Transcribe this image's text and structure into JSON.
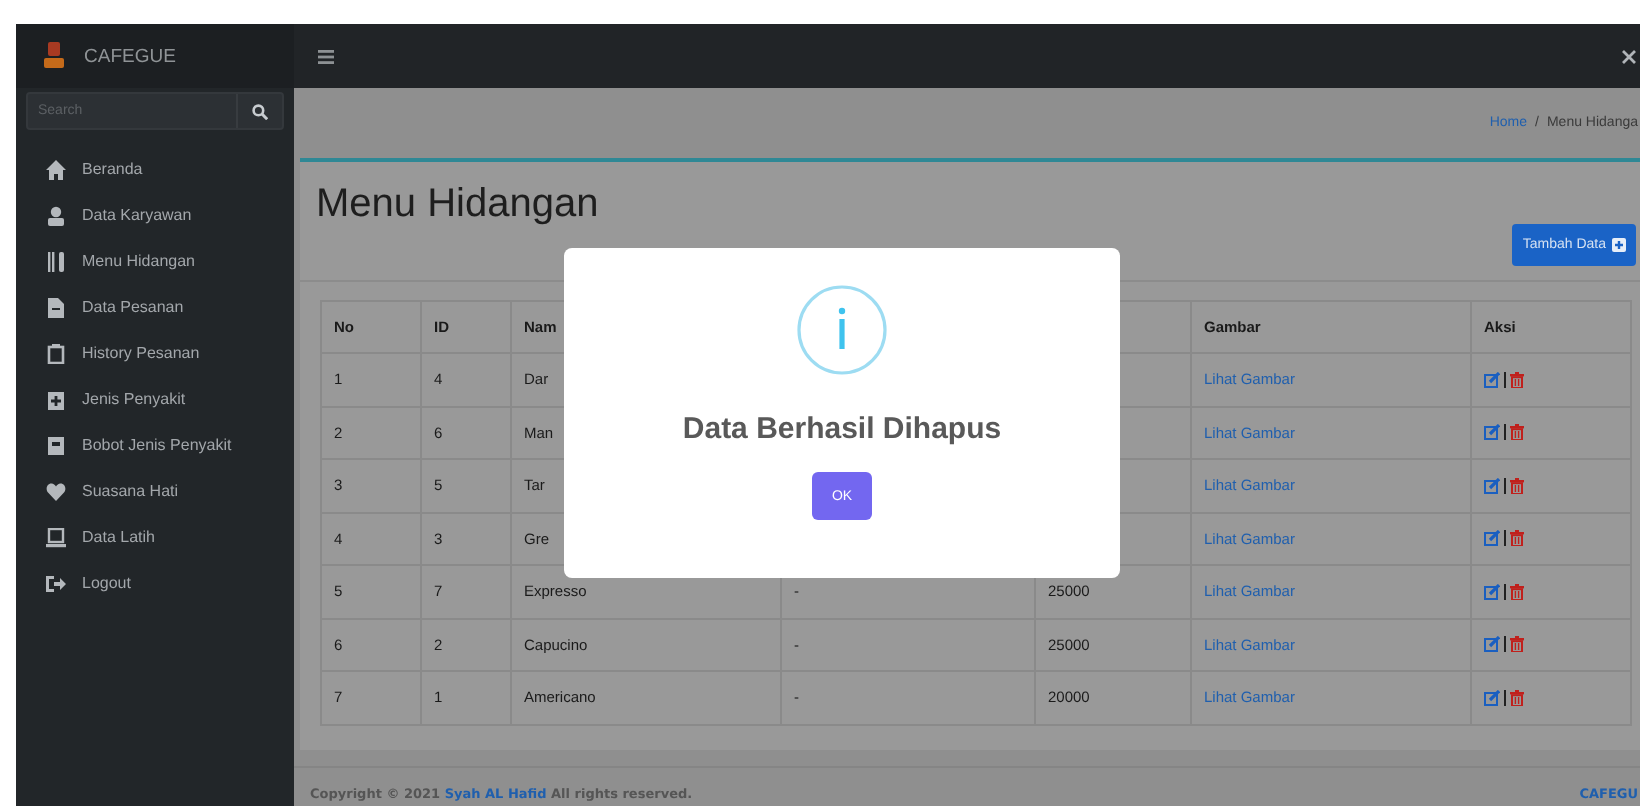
{
  "brand": {
    "name": "CAFEGUE"
  },
  "search": {
    "placeholder": "Search"
  },
  "sidebar": {
    "items": [
      {
        "label": "Beranda"
      },
      {
        "label": "Data Karyawan"
      },
      {
        "label": "Menu Hidangan"
      },
      {
        "label": "Data Pesanan"
      },
      {
        "label": "History Pesanan"
      },
      {
        "label": "Jenis Penyakit"
      },
      {
        "label": "Bobot Jenis Penyakit"
      },
      {
        "label": "Suasana Hati"
      },
      {
        "label": "Data Latih"
      },
      {
        "label": "Logout"
      }
    ]
  },
  "breadcrumb": {
    "items": [
      {
        "label": "Home",
        "kind": "link"
      },
      {
        "label": "Menu Hidanga",
        "kind": "current"
      }
    ],
    "separator": "/"
  },
  "page": {
    "title": "Menu Hidangan",
    "add_button": "Tambah Data"
  },
  "table": {
    "columns": {
      "no": "No",
      "id": "ID",
      "name": "Nam",
      "gambar": "Gambar",
      "aksi": "Aksi"
    },
    "rows": [
      {
        "no": "1",
        "id": "4",
        "name": "Dar",
        "gambar": "Lihat Gambar"
      },
      {
        "no": "2",
        "id": "6",
        "name": "Man",
        "gambar": "Lihat Gambar"
      },
      {
        "no": "3",
        "id": "5",
        "name": "Tar",
        "gambar": "Lihat Gambar"
      },
      {
        "no": "4",
        "id": "3",
        "name": "Gre",
        "gambar": "Lihat Gambar"
      },
      {
        "no": "5",
        "id": "7",
        "name": "Expresso",
        "column_4": "-",
        "column_5": "25000",
        "gambar": "Lihat Gambar"
      },
      {
        "no": "6",
        "id": "2",
        "name": "Capucino",
        "column_4": "-",
        "column_5": "25000",
        "gambar": "Lihat Gambar"
      },
      {
        "no": "7",
        "id": "1",
        "name": "Americano",
        "column_4": "-",
        "column_5": "20000",
        "gambar": "Lihat Gambar"
      }
    ]
  },
  "dialog": {
    "title": "Data Berhasil Dihapus",
    "button": "OK"
  },
  "footer": {
    "prefix": "Copyright © 2021",
    "author": "Syah AL Hafid",
    "suffix": "All rights reserved.",
    "brand": "CAFEGU"
  }
}
